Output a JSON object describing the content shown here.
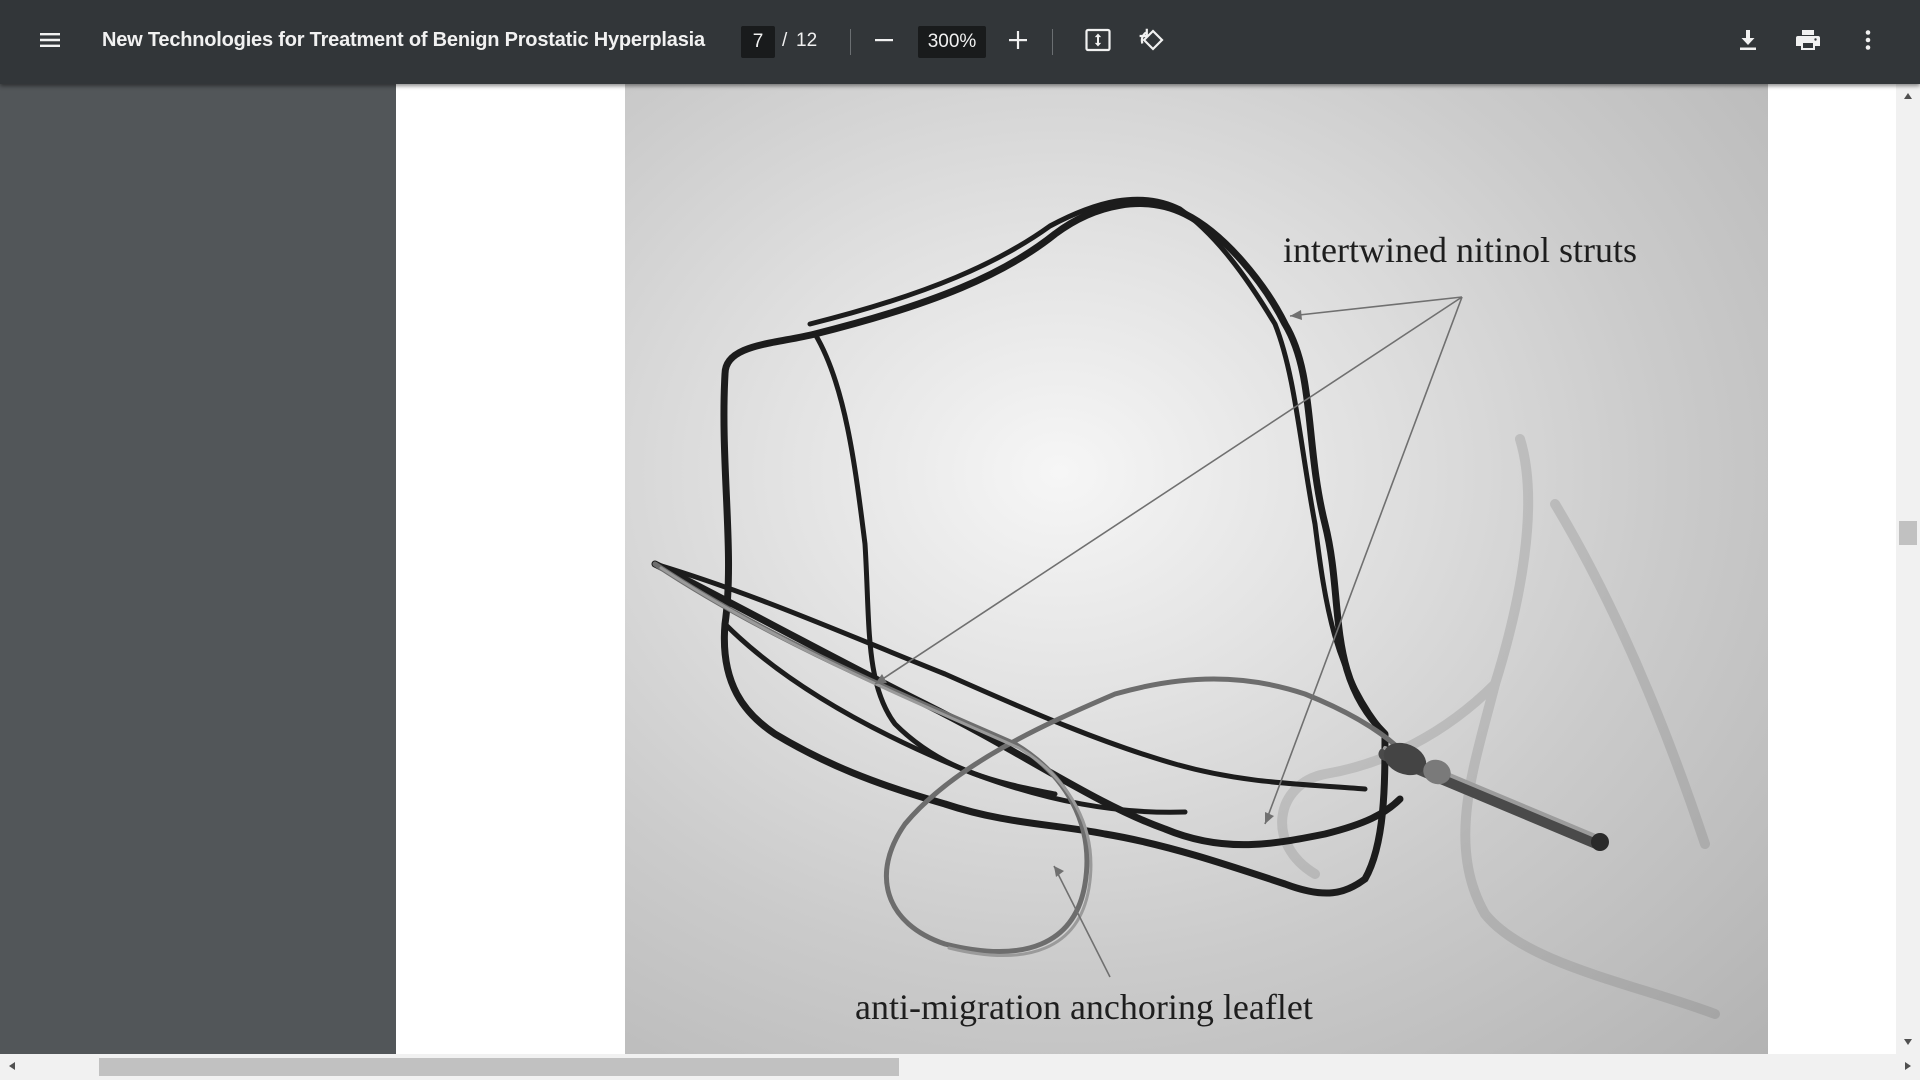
{
  "toolbar": {
    "title": "New Technologies for Treatment of Benign Prostatic Hyperplasia",
    "current_page": "7",
    "page_separator": "/",
    "total_pages": "12",
    "zoom": "300%",
    "icons": {
      "menu": "menu-icon",
      "zoom_out": "minus-icon",
      "zoom_in": "plus-icon",
      "fit": "fit-to-page-icon",
      "rotate": "rotate-counterclockwise-icon",
      "download": "download-icon",
      "print": "print-icon",
      "more": "more-vertical-icon"
    }
  },
  "figure": {
    "label_struts": "intertwined nitinol struts",
    "label_anchor": "anti-migration anchoring leaflet"
  },
  "scrollbars": {
    "vertical_position": 0.46,
    "horizontal_position": 0.07
  },
  "colors": {
    "toolbar_bg": "#323639",
    "viewer_bg": "#525659",
    "input_bg": "#191b1c",
    "text": "#f1f1f1"
  }
}
